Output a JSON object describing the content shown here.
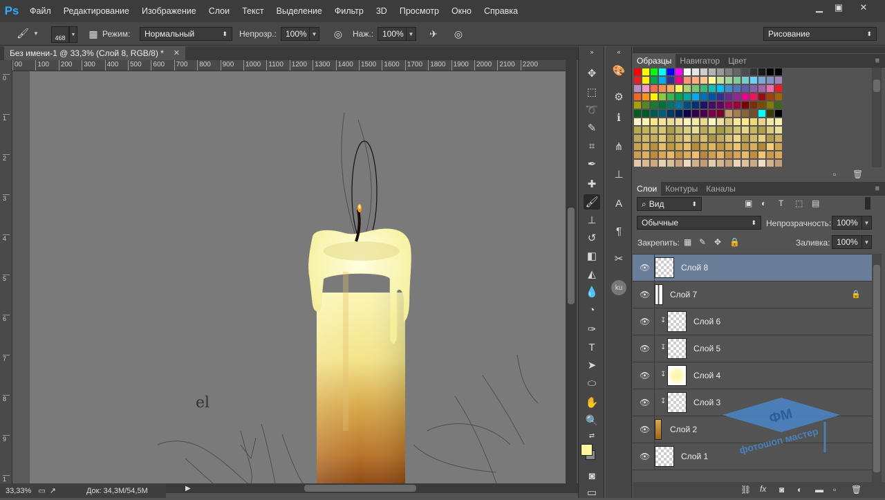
{
  "app": {
    "logo": "Ps"
  },
  "menu": [
    "Файл",
    "Редактирование",
    "Изображение",
    "Слои",
    "Текст",
    "Выделение",
    "Фильтр",
    "3D",
    "Просмотр",
    "Окно",
    "Справка"
  ],
  "options": {
    "brush_size": "468",
    "mode_label": "Режим:",
    "mode_value": "Нормальный",
    "opacity_label": "Непрозр.:",
    "opacity_value": "100%",
    "pressure_label": "Наж.:",
    "pressure_value": "100%",
    "workspace": "Рисование"
  },
  "document": {
    "tab_title": "Без имени-1 @ 33,3% (Слой 8, RGB/8) *",
    "zoom": "33,33%",
    "doc_size": "Док: 34,3M/54,5M"
  },
  "ruler": {
    "h_labels": [
      "00",
      "100",
      "200",
      "300",
      "400",
      "500",
      "600",
      "700",
      "800",
      "900",
      "1000",
      "1100",
      "1200",
      "1300",
      "1400",
      "1500",
      "1600",
      "1700",
      "1800",
      "1900",
      "2000",
      "2100",
      "2200"
    ],
    "v_labels": [
      "0",
      "1",
      "2",
      "3",
      "4",
      "5",
      "6",
      "7",
      "8",
      "9",
      "1"
    ]
  },
  "canvas": {
    "stroke_text": "el"
  },
  "swatches_panel": {
    "tabs": [
      "Образцы",
      "Навигатор",
      "Цвет"
    ],
    "rows": [
      [
        "#ff0000",
        "#ffff00",
        "#00ff00",
        "#00ffff",
        "#0000ff",
        "#ff00ff",
        "#ffffff",
        "#e6e6e6",
        "#cccccc",
        "#b3b3b3",
        "#999999",
        "#808080",
        "#666666",
        "#4d4d4d",
        "#333333",
        "#1a1a1a",
        "#000000",
        "#000000"
      ],
      [
        "#ee1d24",
        "#fff200",
        "#00a651",
        "#00aeef",
        "#2e3192",
        "#ec008c",
        "#f7977a",
        "#fbad82",
        "#fdc68c",
        "#fff799",
        "#c4df9b",
        "#a3d39c",
        "#82ca9c",
        "#7accc8",
        "#6dcff6",
        "#7da7d9",
        "#8393ca",
        "#a186be"
      ],
      [
        "#bd8cbf",
        "#f49ac1",
        "#f26c4f",
        "#f68e55",
        "#fbaf5c",
        "#fff467",
        "#acd372",
        "#7cc576",
        "#3bb878",
        "#1abbb4",
        "#00bff3",
        "#438ccb",
        "#5574b9",
        "#605ca8",
        "#855fa8",
        "#a763a8",
        "#f06ea9",
        "#ed1c24"
      ],
      [
        "#f26522",
        "#f7941d",
        "#fff200",
        "#8dc63f",
        "#39b54a",
        "#00a651",
        "#00a99d",
        "#00aeef",
        "#0072bc",
        "#0054a6",
        "#2e3192",
        "#662d91",
        "#92278f",
        "#ec008c",
        "#ed145b",
        "#9e0b0f",
        "#a0410d",
        "#a36209"
      ],
      [
        "#aba000",
        "#598527",
        "#1a7b30",
        "#007236",
        "#00746b",
        "#0076a3",
        "#004b80",
        "#003471",
        "#1b1464",
        "#440e62",
        "#630460",
        "#9e005d",
        "#9e0039",
        "#790000",
        "#7b2e00",
        "#7d4900",
        "#827b00",
        "#406618"
      ],
      [
        "#005e20",
        "#005826",
        "#005952",
        "#005b7f",
        "#003663",
        "#002157",
        "#0d004c",
        "#32004b",
        "#4b0049",
        "#7b0046",
        "#7a0026",
        "#c69c6d",
        "#a67c52",
        "#8c6239",
        "#754c24",
        "#00ffff",
        "#3c3c00",
        "#000000"
      ],
      [
        "#fdf6c9",
        "#fff5b0",
        "#fde68a",
        "#f5e39c",
        "#eadb9c",
        "#f1e2b0",
        "#fff3bd",
        "#f5eaa8",
        "#e8d98c",
        "#fff7c2",
        "#eee0a0",
        "#dac97e",
        "#f8e99e",
        "#ffe98a",
        "#f0d878",
        "#e6d28a",
        "#f6e6a8",
        "#fff1b0"
      ],
      [
        "#b7a94c",
        "#c2b35a",
        "#cbbc66",
        "#d5c672",
        "#a99d4a",
        "#c4b766",
        "#dccf84",
        "#e8dc96",
        "#b8ab58",
        "#cfc06c",
        "#a89a42",
        "#bdaf5a",
        "#d2c472",
        "#e4d78c",
        "#c6b860",
        "#ae9f48",
        "#d9cb7c",
        "#ecdf9a"
      ],
      [
        "#bfa85a",
        "#d1b866",
        "#c7af5f",
        "#e2c978",
        "#b89f4f",
        "#cfb566",
        "#e5cc80",
        "#c1a955",
        "#d7be6e",
        "#ad9547",
        "#c3ab5e",
        "#dac174",
        "#f0d68a",
        "#bba350",
        "#d4bb6a",
        "#e8cf82",
        "#b39b4b",
        "#ccb362"
      ],
      [
        "#c9a24a",
        "#d8b25a",
        "#b8913c",
        "#e6c068",
        "#c0993f",
        "#d3ab52",
        "#e8c26a",
        "#b38c38",
        "#cca449",
        "#deb75e",
        "#bf9841",
        "#d6ad56",
        "#ecc46e",
        "#c49c45",
        "#d9b05a",
        "#b08936",
        "#f3cd76",
        "#cfa64e"
      ],
      [
        "#cf9d4e",
        "#e0ae5e",
        "#bd8b3e",
        "#d8a656",
        "#e9b868",
        "#c49243",
        "#dcab5b",
        "#f0be6e",
        "#b88640",
        "#d09e50",
        "#e4b262",
        "#c08e44",
        "#d6a454",
        "#eab866",
        "#bf8c42",
        "#f3c272",
        "#ca9848",
        "#dca95a"
      ],
      [
        "#e3c8a8",
        "#d8b894",
        "#cda880",
        "#e8d0b4",
        "#dbbe9c",
        "#c9a47e",
        "#eed8be",
        "#d1b08c",
        "#c29c76",
        "#e5ccae",
        "#d5b590",
        "#c6a07a",
        "#ebd4b8",
        "#dcc09e",
        "#cbaa84",
        "#f0dcc4",
        "#d3b28e",
        "#c49e78"
      ]
    ]
  },
  "layers_panel": {
    "tabs": [
      "Слои",
      "Контуры",
      "Каналы"
    ],
    "filter_kind": "Вид",
    "blend_mode": "Обычные",
    "opacity_label": "Непрозрачность:",
    "opacity_value": "100%",
    "lock_label": "Закрепить:",
    "fill_label": "Заливка:",
    "fill_value": "100%",
    "layers": [
      {
        "name": "Слой 8",
        "selected": true,
        "clipped": false,
        "locked": false
      },
      {
        "name": "Слой 7",
        "selected": false,
        "clipped": false,
        "locked": true
      },
      {
        "name": "Слой 6",
        "selected": false,
        "clipped": true,
        "locked": false
      },
      {
        "name": "Слой 5",
        "selected": false,
        "clipped": true,
        "locked": false
      },
      {
        "name": "Слой 4",
        "selected": false,
        "clipped": true,
        "locked": false
      },
      {
        "name": "Слой 3",
        "selected": false,
        "clipped": true,
        "locked": false
      },
      {
        "name": "Слой 2",
        "selected": false,
        "clipped": false,
        "locked": false
      },
      {
        "name": "Слой 1",
        "selected": false,
        "clipped": false,
        "locked": false
      }
    ]
  },
  "watermark": {
    "logo": "ФМ",
    "text": "фотошоп мастер"
  },
  "colors": {
    "foreground": "#fff59a",
    "background": "#8a8a8a",
    "accent_selected": "#6a7d99"
  }
}
